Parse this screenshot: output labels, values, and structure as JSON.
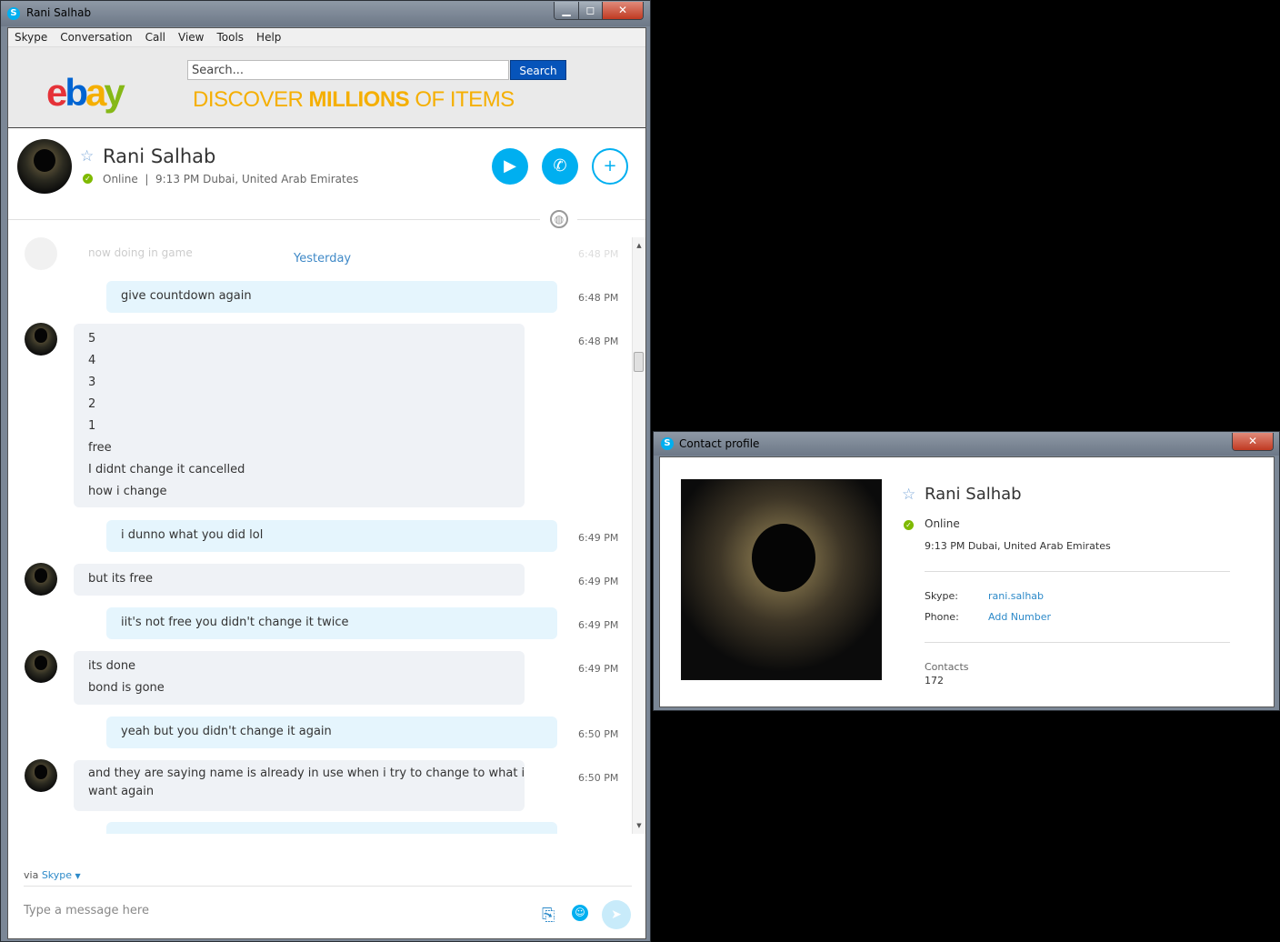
{
  "main_window": {
    "title": "Rani Salhab",
    "controls": {
      "minimize": "▁",
      "maximize": "◻",
      "close": "✕"
    }
  },
  "menu": [
    "Skype",
    "Conversation",
    "Call",
    "View",
    "Tools",
    "Help"
  ],
  "ad": {
    "logo": {
      "e": "e",
      "b": "b",
      "a": "a",
      "y": "y"
    },
    "search_placeholder": "Search...",
    "search_button": "Search",
    "tagline_pre": "DISCOVER ",
    "tagline_bold": "MILLIONS",
    "tagline_post": " OF ITEMS"
  },
  "contact": {
    "name": "Rani Salhab",
    "status": "Online",
    "local_time": "9:13 PM Dubai, United Arab Emirates",
    "status_line": "Online  |  9:13 PM Dubai, United Arab Emirates"
  },
  "chat": {
    "ghost_text": "now doing in game",
    "ghost_time": "6:48 PM",
    "day_label": "Yesterday",
    "messages": [
      {
        "dir": "out",
        "lines": [
          "give countdown again"
        ],
        "time": "6:48 PM"
      },
      {
        "dir": "in",
        "lines": [
          "5",
          "4",
          "3",
          "2",
          "1",
          "free",
          "I didnt change it cancelled",
          "how i change"
        ],
        "time": "6:48 PM"
      },
      {
        "dir": "out",
        "lines": [
          "i dunno what you did lol"
        ],
        "time": "6:49 PM"
      },
      {
        "dir": "in",
        "lines": [
          "but its free"
        ],
        "time": "6:49 PM"
      },
      {
        "dir": "out",
        "lines": [
          "iit's not free you didn't change it twice"
        ],
        "time": "6:49 PM"
      },
      {
        "dir": "in",
        "lines": [
          "its done",
          "bond is gone"
        ],
        "time": "6:49 PM"
      },
      {
        "dir": "out",
        "lines": [
          "yeah but you didn't change it again"
        ],
        "time": "6:50 PM"
      },
      {
        "dir": "in",
        "lines": [
          "and they are saying name is already in use when i try to change to what i",
          "want again"
        ],
        "time": "6:50 PM"
      }
    ]
  },
  "compose": {
    "via_prefix": "via ",
    "via_service": "Skype",
    "placeholder": "Type a message here"
  },
  "profile_window": {
    "title": "Contact profile",
    "close": "✕",
    "name": "Rani Salhab",
    "status": "Online",
    "local_time": "9:13 PM Dubai, United Arab Emirates",
    "skype_label": "Skype:",
    "skype_value": "rani.salhab",
    "phone_label": "Phone:",
    "phone_value": "Add Number",
    "contacts_label": "Contacts",
    "contacts_value": "172"
  },
  "colors": {
    "skype_blue": "#00aff0",
    "online_green": "#7fba00",
    "link_blue": "#2d8ac9"
  }
}
